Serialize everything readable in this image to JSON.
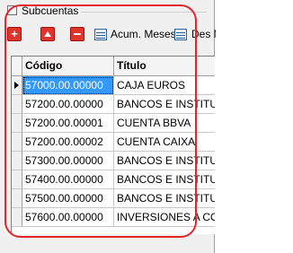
{
  "panel": {
    "title": "Subcuentas",
    "checkbox_checked": false
  },
  "toolbar": {
    "add_icon": "plus-icon",
    "up_icon": "arrow-up-icon",
    "remove_icon": "minus-icon",
    "acum_label": "Acum. Meses",
    "des_label": "Des M"
  },
  "table": {
    "columns": [
      "Código",
      "Título"
    ],
    "rows": [
      {
        "codigo": "57000.00.00000",
        "titulo": "CAJA EUROS",
        "selected": true
      },
      {
        "codigo": "57200.00.00000",
        "titulo": "BANCOS E INSTITUC"
      },
      {
        "codigo": "57200.00.00001",
        "titulo": "CUENTA BBVA"
      },
      {
        "codigo": "57200.00.00002",
        "titulo": "CUENTA CAIXA"
      },
      {
        "codigo": "57300.00.00000",
        "titulo": "BANCOS E INSTITUC"
      },
      {
        "codigo": "57400.00.00000",
        "titulo": "BANCOS E INSTITUC"
      },
      {
        "codigo": "57500.00.00000",
        "titulo": "BANCOS E INSTITUC"
      },
      {
        "codigo": "57600.00.00000",
        "titulo": "INVERSIONES A COR"
      }
    ]
  },
  "colors": {
    "annotation": "#e3242b",
    "selection": "#3399ff",
    "button_red": "#e0342a"
  }
}
